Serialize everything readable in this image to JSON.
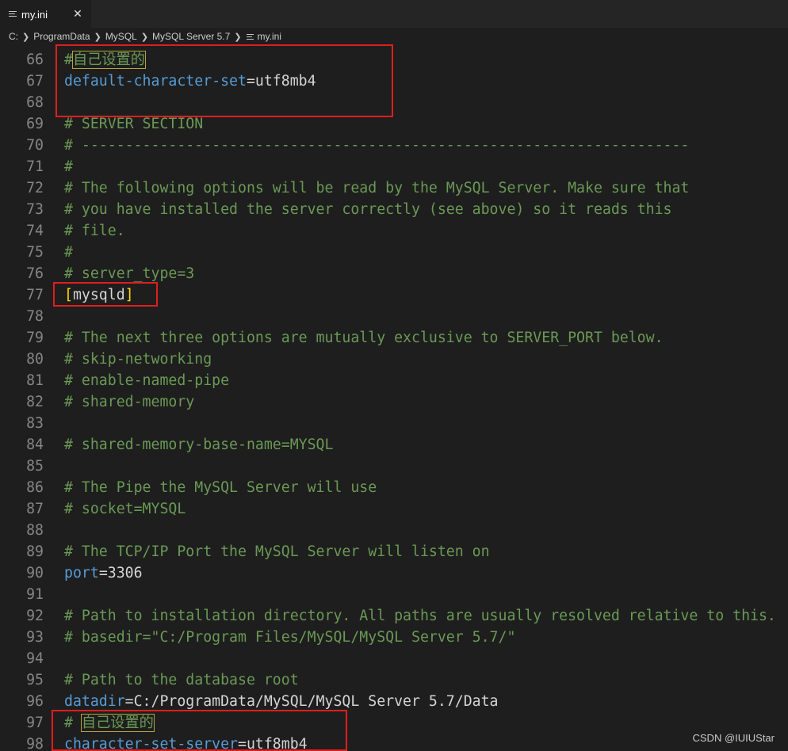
{
  "tab": {
    "label": "my.ini",
    "file_icon": "lines-icon",
    "close_glyph": "✕",
    "close_icon": "close-icon"
  },
  "breadcrumb": {
    "items": [
      "C:",
      "ProgramData",
      "MySQL",
      "MySQL Server 5.7",
      "my.ini"
    ],
    "separator_icon": "chevron-right-icon"
  },
  "editor": {
    "lines": [
      {
        "n": "66",
        "tokens": [
          {
            "t": "#",
            "c": "comment"
          },
          {
            "t": "自己设置的",
            "c": "comment cjk"
          }
        ]
      },
      {
        "n": "67",
        "tokens": [
          {
            "t": "default-character-set",
            "c": "key"
          },
          {
            "t": "=",
            "c": "op"
          },
          {
            "t": "utf8mb4",
            "c": "val"
          }
        ]
      },
      {
        "n": "68",
        "tokens": []
      },
      {
        "n": "69",
        "tokens": [
          {
            "t": "# SERVER SECTION",
            "c": "comment"
          }
        ]
      },
      {
        "n": "70",
        "tokens": [
          {
            "t": "# ----------------------------------------------------------------------",
            "c": "comment"
          }
        ]
      },
      {
        "n": "71",
        "tokens": [
          {
            "t": "#",
            "c": "comment"
          }
        ]
      },
      {
        "n": "72",
        "tokens": [
          {
            "t": "# The following options will be read by the MySQL Server. Make sure that",
            "c": "comment"
          }
        ]
      },
      {
        "n": "73",
        "tokens": [
          {
            "t": "# you have installed the server correctly (see above) so it reads this",
            "c": "comment"
          }
        ]
      },
      {
        "n": "74",
        "tokens": [
          {
            "t": "# file.",
            "c": "comment"
          }
        ]
      },
      {
        "n": "75",
        "tokens": [
          {
            "t": "#",
            "c": "comment"
          }
        ]
      },
      {
        "n": "76",
        "tokens": [
          {
            "t": "# server_type=3",
            "c": "comment"
          }
        ]
      },
      {
        "n": "77",
        "tokens": [
          {
            "t": "[",
            "c": "bracket"
          },
          {
            "t": "mysqld",
            "c": "section"
          },
          {
            "t": "]",
            "c": "bracket"
          }
        ]
      },
      {
        "n": "78",
        "tokens": []
      },
      {
        "n": "79",
        "tokens": [
          {
            "t": "# The next three options are mutually exclusive to SERVER_PORT below.",
            "c": "comment"
          }
        ]
      },
      {
        "n": "80",
        "tokens": [
          {
            "t": "# skip-networking",
            "c": "comment"
          }
        ]
      },
      {
        "n": "81",
        "tokens": [
          {
            "t": "# enable-named-pipe",
            "c": "comment"
          }
        ]
      },
      {
        "n": "82",
        "tokens": [
          {
            "t": "# shared-memory",
            "c": "comment"
          }
        ]
      },
      {
        "n": "83",
        "tokens": []
      },
      {
        "n": "84",
        "tokens": [
          {
            "t": "# shared-memory-base-name=MYSQL",
            "c": "comment"
          }
        ]
      },
      {
        "n": "85",
        "tokens": []
      },
      {
        "n": "86",
        "tokens": [
          {
            "t": "# The Pipe the MySQL Server will use",
            "c": "comment"
          }
        ]
      },
      {
        "n": "87",
        "tokens": [
          {
            "t": "# socket=MYSQL",
            "c": "comment"
          }
        ]
      },
      {
        "n": "88",
        "tokens": []
      },
      {
        "n": "89",
        "tokens": [
          {
            "t": "# The TCP/IP Port the MySQL Server will listen on",
            "c": "comment"
          }
        ]
      },
      {
        "n": "90",
        "tokens": [
          {
            "t": "port",
            "c": "key"
          },
          {
            "t": "=",
            "c": "op"
          },
          {
            "t": "3306",
            "c": "val"
          }
        ]
      },
      {
        "n": "91",
        "tokens": []
      },
      {
        "n": "92",
        "tokens": [
          {
            "t": "# Path to installation directory. All paths are usually resolved relative to this.",
            "c": "comment"
          }
        ]
      },
      {
        "n": "93",
        "tokens": [
          {
            "t": "# basedir=\"C:/Program Files/MySQL/MySQL Server 5.7/\"",
            "c": "comment"
          }
        ]
      },
      {
        "n": "94",
        "tokens": []
      },
      {
        "n": "95",
        "tokens": [
          {
            "t": "# Path to the database root",
            "c": "comment"
          }
        ]
      },
      {
        "n": "96",
        "tokens": [
          {
            "t": "datadir",
            "c": "key"
          },
          {
            "t": "=",
            "c": "op"
          },
          {
            "t": "C:/ProgramData/MySQL/MySQL Server 5.7/Data",
            "c": "val"
          }
        ]
      },
      {
        "n": "97",
        "tokens": [
          {
            "t": "# ",
            "c": "comment"
          },
          {
            "t": "自己设置的",
            "c": "comment cjk"
          }
        ]
      },
      {
        "n": "98",
        "tokens": [
          {
            "t": "character-set-server",
            "c": "key"
          },
          {
            "t": "=",
            "c": "op"
          },
          {
            "t": "utf8mb4",
            "c": "val"
          }
        ]
      }
    ]
  },
  "watermark": "CSDN @IUIUStar",
  "colors": {
    "background": "#1e1e1e",
    "comment": "#6a9955",
    "key": "#569cd6",
    "highlight_box": "#e01e1e",
    "bracket": "#ffd700"
  }
}
